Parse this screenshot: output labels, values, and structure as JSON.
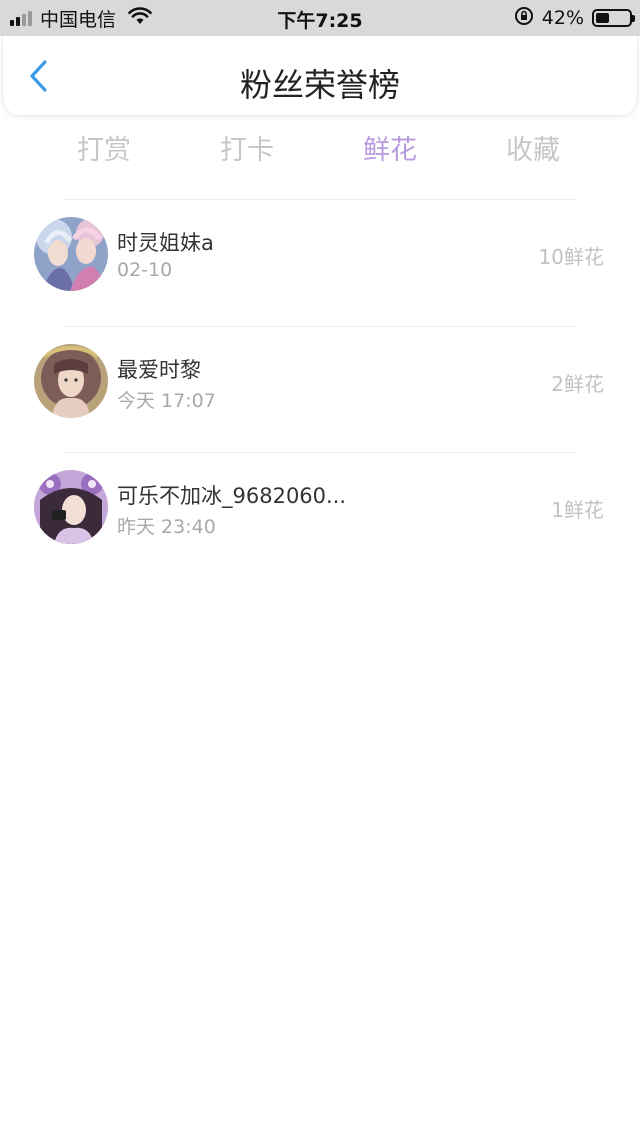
{
  "status_bar": {
    "carrier": "中国电信",
    "time": "下午7:25",
    "battery_percent_text": "42%",
    "battery_level": 0.42,
    "icons": [
      "signal-icon",
      "wifi-icon",
      "rotation-lock-icon",
      "battery-icon"
    ]
  },
  "nav": {
    "title": "粉丝荣誉榜",
    "back_icon": "chevron-left-icon",
    "accent_color": "#3a9be6"
  },
  "tabs": {
    "items": [
      {
        "label": "打赏",
        "active": false
      },
      {
        "label": "打卡",
        "active": false
      },
      {
        "label": "鲜花",
        "active": true
      },
      {
        "label": "收藏",
        "active": false
      }
    ],
    "active_color": "#b99be0",
    "inactive_color": "#c7c7c7"
  },
  "list": {
    "items": [
      {
        "name": "时灵姐妹a",
        "time": "02-10",
        "count": "10鲜花"
      },
      {
        "name": "最爱时黎",
        "time": "今天 17:07",
        "count": "2鲜花"
      },
      {
        "name": "可乐不加冰_9682060...",
        "time": "昨天 23:40",
        "count": "1鲜花"
      }
    ]
  }
}
